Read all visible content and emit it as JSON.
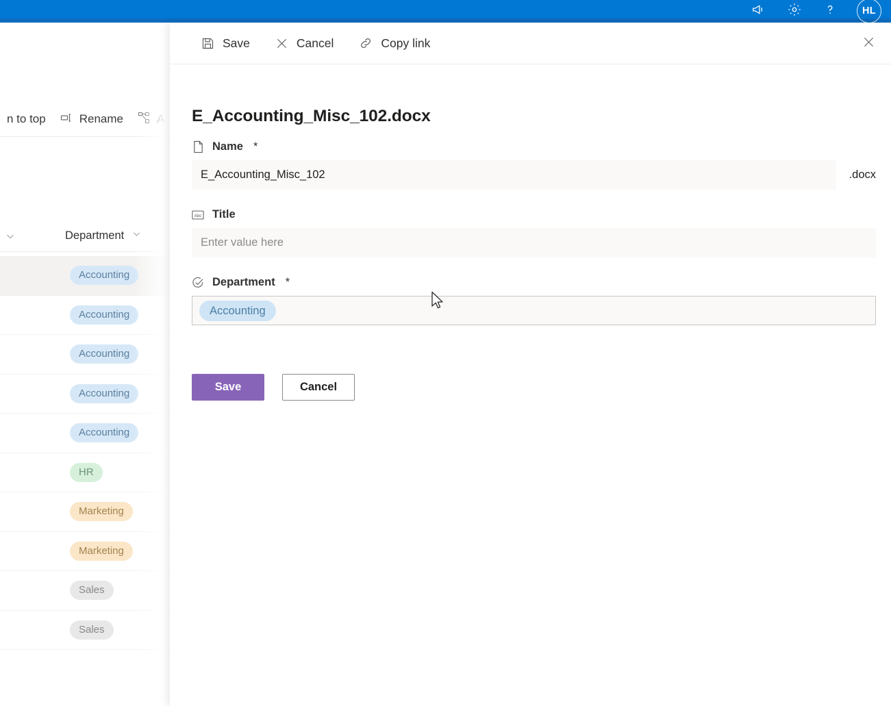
{
  "suite_header": {
    "background_color": "#0078d4",
    "icons": [
      {
        "name": "megaphone-icon",
        "label": "Announcements"
      },
      {
        "name": "gear-icon",
        "label": "Settings"
      },
      {
        "name": "help-icon",
        "label": "?"
      }
    ],
    "avatar_initials": "HL"
  },
  "background_list": {
    "commands": [
      {
        "name": "pin-to-top-command",
        "label": "n to top"
      },
      {
        "name": "rename-command",
        "label": "Rename"
      },
      {
        "name": "automate-command",
        "label": "A"
      }
    ],
    "column_header": {
      "department_label": "Department"
    },
    "rows": [
      {
        "department": "Accounting",
        "pill_style": "pill-blue",
        "selected": true
      },
      {
        "department": "Accounting",
        "pill_style": "pill-blue",
        "selected": false
      },
      {
        "department": "Accounting",
        "pill_style": "pill-blue",
        "selected": false
      },
      {
        "department": "Accounting",
        "pill_style": "pill-blue",
        "selected": false
      },
      {
        "department": "Accounting",
        "pill_style": "pill-blue",
        "selected": false
      },
      {
        "department": "HR",
        "pill_style": "pill-green",
        "selected": false
      },
      {
        "department": "Marketing",
        "pill_style": "pill-orange",
        "selected": false
      },
      {
        "department": "Marketing",
        "pill_style": "pill-orange",
        "selected": false
      },
      {
        "department": "Sales",
        "pill_style": "pill-gray",
        "selected": false
      },
      {
        "department": "Sales",
        "pill_style": "pill-gray",
        "selected": false
      }
    ]
  },
  "panel": {
    "commandbar": {
      "save_label": "Save",
      "cancel_label": "Cancel",
      "copy_link_label": "Copy link"
    },
    "file_title": "E_Accounting_Misc_102.docx",
    "fields": {
      "name": {
        "label": "Name",
        "required_marker": "*",
        "icon": "document-icon",
        "value": "E_Accounting_Misc_102",
        "extension": ".docx"
      },
      "title": {
        "label": "Title",
        "required_marker": "",
        "icon": "abc-text-icon",
        "value": "",
        "placeholder": "Enter value here"
      },
      "department": {
        "label": "Department",
        "required_marker": "*",
        "icon": "choice-check-icon",
        "value": "Accounting"
      }
    },
    "actions": {
      "save_label": "Save",
      "cancel_label": "Cancel",
      "save_color": "#8764b8"
    }
  }
}
